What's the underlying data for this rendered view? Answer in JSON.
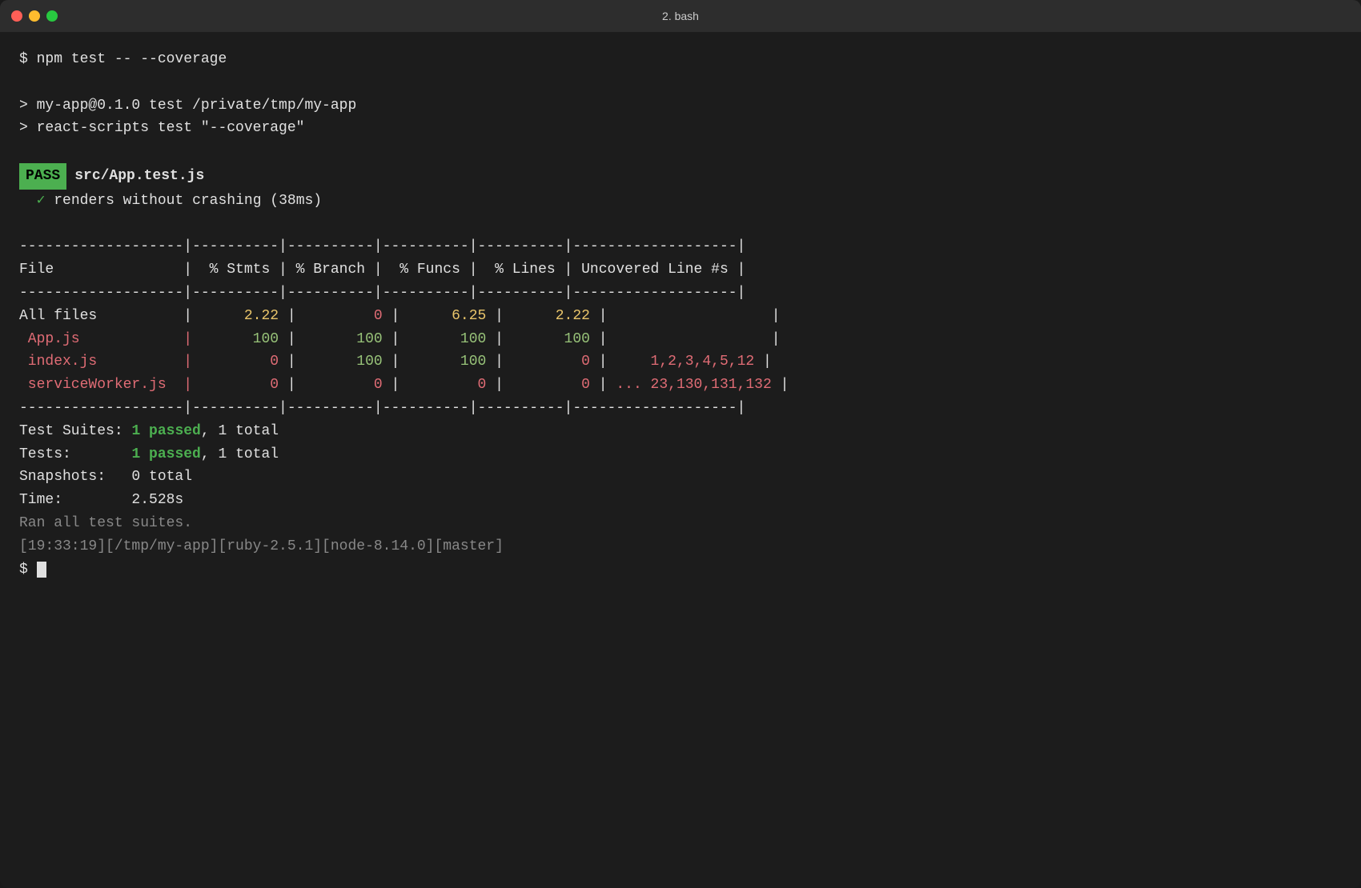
{
  "window": {
    "title": "2. bash"
  },
  "terminal": {
    "command": "$ npm test -- --coverage",
    "output1": "> my-app@0.1.0 test /private/tmp/my-app",
    "output2": "> react-scripts test \"--coverage\"",
    "pass_badge": "PASS",
    "pass_file": "src/App.test.js",
    "check_line": "✓ renders without crashing (38ms)",
    "separator": "-------------------|----------|----------|----------|----------|-------------------|",
    "header": "File               |  % Stmts | % Branch |  % Funcs |  % Lines | Uncovered Line #s |",
    "rows": [
      {
        "file": "All files",
        "stmts": "2.22",
        "branch": "0",
        "funcs": "6.25",
        "lines": "2.22",
        "uncovered": "",
        "file_color": "white",
        "stmts_color": "yellow",
        "branch_color": "red",
        "funcs_color": "yellow",
        "lines_color": "yellow"
      },
      {
        "file": "App.js",
        "stmts": "100",
        "branch": "100",
        "funcs": "100",
        "lines": "100",
        "uncovered": "",
        "file_color": "pink",
        "stmts_color": "green",
        "branch_color": "green",
        "funcs_color": "green",
        "lines_color": "green"
      },
      {
        "file": "index.js",
        "stmts": "0",
        "branch": "100",
        "funcs": "100",
        "lines": "0",
        "uncovered": "1,2,3,4,5,12",
        "file_color": "pink",
        "stmts_color": "red",
        "branch_color": "green",
        "funcs_color": "green",
        "lines_color": "red"
      },
      {
        "file": "serviceWorker.js",
        "stmts": "0",
        "branch": "0",
        "funcs": "0",
        "lines": "0",
        "uncovered": "... 23,130,131,132",
        "file_color": "pink",
        "stmts_color": "red",
        "branch_color": "red",
        "funcs_color": "red",
        "lines_color": "red"
      }
    ],
    "test_suites": "Test Suites:",
    "test_suites_val": "1 passed, 1 total",
    "tests": "Tests:",
    "tests_val": "1 passed, 1 total",
    "snapshots": "Snapshots:",
    "snapshots_val": "0 total",
    "time": "Time:",
    "time_val": "2.528s",
    "ran_all": "Ran all test suites.",
    "prompt_line": "[19:33:19][/tmp/my-app][ruby-2.5.1][node-8.14.0][master]",
    "final_prompt": "$ "
  }
}
